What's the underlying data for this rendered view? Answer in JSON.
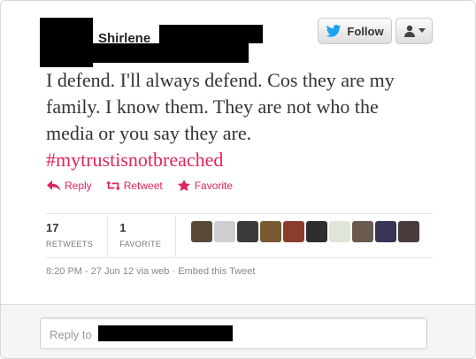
{
  "author": {
    "name": "Shirlene"
  },
  "buttons": {
    "follow_label": "Follow"
  },
  "tweet": {
    "text_lines": [
      "I defend. I'll always defend. Cos they are my",
      "family. I know them. They are not who the",
      "media or you say they are."
    ],
    "hashtag": "#mytrustisnotbreached"
  },
  "actions": {
    "reply": "Reply",
    "retweet": "Retweet",
    "favorite": "Favorite"
  },
  "stats": {
    "retweets_count": "17",
    "retweets_label": "RETWEETS",
    "favorites_count": "1",
    "favorites_label": "FAVORITE"
  },
  "favoriters": [
    {
      "icon": "favoriter-avatar",
      "color": "#5b4a3a"
    },
    {
      "icon": "favoriter-avatar",
      "color": "#cfcfcf"
    },
    {
      "icon": "favoriter-avatar",
      "color": "#3b3b3b"
    },
    {
      "icon": "favoriter-avatar",
      "color": "#7a5a32"
    },
    {
      "icon": "favoriter-avatar",
      "color": "#8a3d2a"
    },
    {
      "icon": "favoriter-avatar",
      "color": "#2e2e2e"
    },
    {
      "icon": "favoriter-avatar",
      "color": "#dfe6d5"
    },
    {
      "icon": "favoriter-avatar",
      "color": "#6b5a4e"
    },
    {
      "icon": "favoriter-avatar",
      "color": "#3a3555"
    },
    {
      "icon": "favoriter-avatar",
      "color": "#4a3a3a"
    }
  ],
  "meta": {
    "timestamp": "8:20 PM - 27 Jun 12 via web",
    "dot": "·",
    "embed": "Embed this Tweet"
  },
  "reply": {
    "placeholder": "Reply to"
  },
  "colors": {
    "accent": "#e0245e",
    "twitter_blue": "#1da1f2"
  }
}
